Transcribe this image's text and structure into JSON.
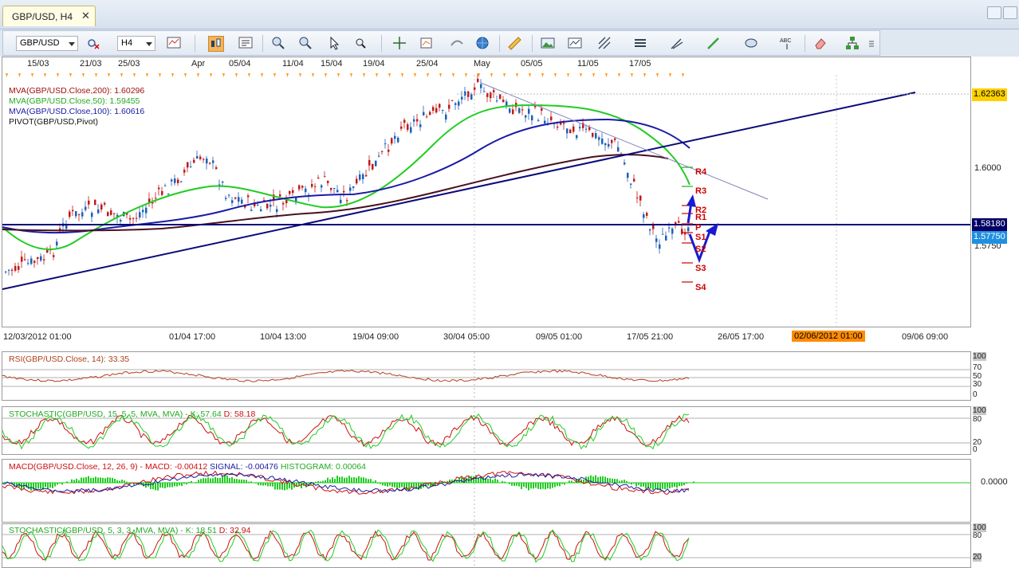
{
  "tab": {
    "title": "GBP/USD, H4",
    "close_glyph": "✕"
  },
  "toolbar": {
    "symbol": "GBP/USD",
    "timeframe": "H4",
    "icons": [
      "compare-icon",
      "chart-type-icon",
      "candle-icon",
      "bar-style-icon",
      "zoom-in-icon",
      "zoom-out-icon",
      "cursor-icon",
      "magnifier-icon",
      "crosshair-icon",
      "indicator-icon",
      "trend-icon",
      "globe-icon",
      "ruler-icon",
      "picture-icon",
      "template-icon",
      "fibonacci-icon",
      "lines-icon",
      "pen-icon",
      "pencil-icon",
      "ellipse-icon",
      "text-icon",
      "eraser-icon",
      "hierarchy-icon",
      "more-icon"
    ]
  },
  "top_dates": [
    "15/03",
    "21/03",
    "25/03",
    "Apr",
    "05/04",
    "11/04",
    "15/04",
    "19/04",
    "25/04",
    "May",
    "05/05",
    "11/05",
    "17/05"
  ],
  "bottom_dates": [
    "12/03/2012 01:00",
    "01/04 17:00",
    "10/04 13:00",
    "19/04 09:00",
    "30/04 05:00",
    "09/05 01:00",
    "17/05 21:00",
    "26/05 17:00",
    "09/06 09:00"
  ],
  "cursor_date": "02/06/2012 01:00",
  "legend": {
    "mva200": "MVA(GBP/USD.Close,200): 1.60296",
    "mva50": "MVA(GBP/USD.Close,50): 1.59455",
    "mva100": "MVA(GBP/USD.Close,100): 1.60616",
    "pivot": "PIVOT(GBP/USD,Pivot)"
  },
  "price_axis": {
    "labels": [
      "1.6000",
      "1.5750"
    ],
    "tag_high": "1.62363",
    "tag_line": "1.58180",
    "tag_last": "1.57750"
  },
  "pivot_levels": [
    "R4",
    "R3",
    "R2",
    "R1",
    "P",
    "S1",
    "S2",
    "S3",
    "S4"
  ],
  "rsi": {
    "label": "RSI(GBP/USD.Close, 14): 33.35",
    "axis": [
      "100",
      "70",
      "50",
      "30",
      "0"
    ]
  },
  "stoch1": {
    "label_a": "STOCHASTIC(GBP/USD, 15, 5, 5, MVA, MVA) -",
    "label_k": "K: 57.64",
    "label_d": "D: 58.18",
    "axis": [
      "100",
      "80",
      "20",
      "0"
    ]
  },
  "macd": {
    "label_a": "MACD(GBP/USD.Close, 12, 26, 9) -",
    "label_macd": "MACD: -0.00412",
    "label_signal": "SIGNAL: -0.00476",
    "label_hist": "HISTOGRAM: 0.00064",
    "axis": [
      "0.0000"
    ]
  },
  "stoch2": {
    "label_a": "STOCHASTIC(GBP/USD, 5, 3, 3, MVA, MVA) -",
    "label_k": "K: 18.51",
    "label_d": "D: 32.94",
    "axis": [
      "100",
      "80",
      "20"
    ]
  },
  "colors": {
    "accent": "#ff8c00",
    "mva50": "#22cc22",
    "mva100": "#1a1aa6",
    "mva200": "#4a1020",
    "pivot": "#cc0000",
    "macd_hist": "#22cc22"
  }
}
